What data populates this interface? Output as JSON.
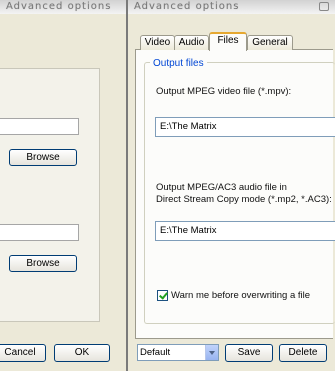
{
  "left_window": {
    "title": "Advanced options",
    "buttons": {
      "browse_1": "Browse",
      "browse_2": "Browse",
      "cancel": "Cancel",
      "ok": "OK"
    }
  },
  "right_window": {
    "title": "Advanced options",
    "tabs": [
      {
        "label": "Video",
        "active": false
      },
      {
        "label": "Audio",
        "active": false
      },
      {
        "label": "Files",
        "active": true
      },
      {
        "label": "General",
        "active": false
      }
    ],
    "group": {
      "title": "Output files",
      "video_label": "Output MPEG video file (*.mpv):",
      "video_value": "E:\\The Matrix",
      "audio_label_line1": "Output MPEG/AC3 audio file in",
      "audio_label_line2": "Direct Stream Copy mode (*.mp2, *.AC3):",
      "audio_value": "E:\\The Matrix",
      "warn_checkbox": {
        "label": "Warn me before overwriting a file",
        "checked": true
      }
    },
    "preset": {
      "selected": "Default"
    },
    "buttons": {
      "save": "Save",
      "delete": "Delete"
    }
  }
}
